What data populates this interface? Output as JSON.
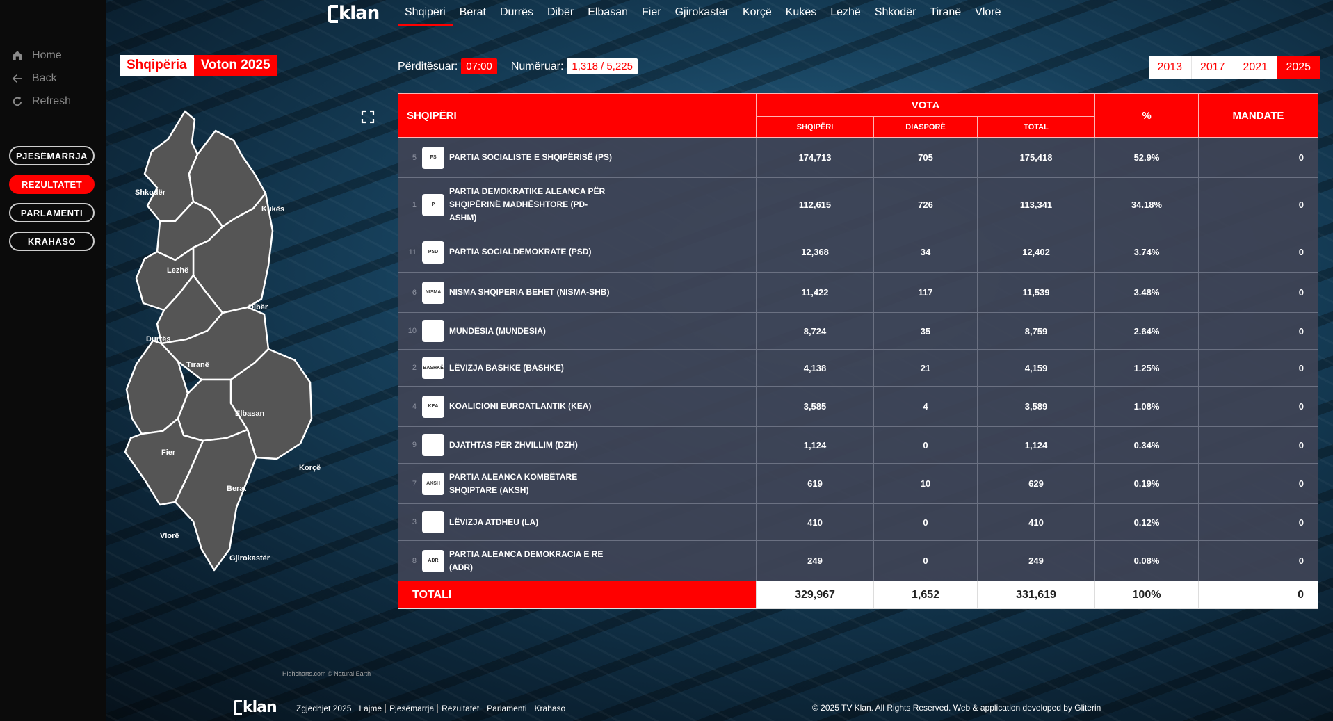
{
  "brand": {
    "logo_text": "klan",
    "footer_logo_text": "klan"
  },
  "sidebar": {
    "home": "Home",
    "back": "Back",
    "refresh": "Refresh",
    "buttons": [
      "PJESËMARRJA",
      "REZULTATET",
      "PARLAMENTI",
      "KRAHASO"
    ],
    "active_button": "REZULTATET"
  },
  "nav": {
    "items": [
      "Shqipëri",
      "Berat",
      "Durrës",
      "Dibër",
      "Elbasan",
      "Fier",
      "Gjirokastër",
      "Korçë",
      "Kukës",
      "Lezhë",
      "Shkodër",
      "Tiranë",
      "Vlorë"
    ],
    "active": "Shqipëri"
  },
  "badge": {
    "left": "Shqipëria",
    "right": "Voton 2025"
  },
  "status": {
    "updated_label": "Përditësuar:",
    "updated_value": "07:00",
    "counted_label": "Numëruar:",
    "counted_value": "1,318 / 5,225"
  },
  "years": {
    "items": [
      "2013",
      "2017",
      "2021",
      "2025"
    ],
    "active": "2025"
  },
  "map": {
    "labels": [
      "Shkodër",
      "Kukës",
      "Lezhë",
      "Dibër",
      "Durrës",
      "Tiranë",
      "Elbasan",
      "Fier",
      "Korçë",
      "Berat",
      "Vlorë",
      "Gjirokastër"
    ],
    "credits": "Highcharts.com © Natural Earth"
  },
  "table": {
    "headers": {
      "region": "SHQIPËRI",
      "votes": "VOTA",
      "percent": "%",
      "seats": "MANDATE",
      "sub_domestic": "SHQIPËRI",
      "sub_diaspora": "DIASPORË",
      "sub_total": "TOTAL"
    },
    "rows": [
      {
        "index": "5",
        "logo": "PS",
        "name": "PARTIA SOCIALISTE E SHQIPËRISË (PS)",
        "domestic": "174,713",
        "diaspora": "705",
        "total": "175,418",
        "percent": "52.9%",
        "seats": "0"
      },
      {
        "index": "1",
        "logo": "P",
        "name": "PARTIA DEMOKRATIKE ALEANCA PËR SHQIPËRINË MADHËSHTORE (PD-ASHM)",
        "domestic": "112,615",
        "diaspora": "726",
        "total": "113,341",
        "percent": "34.18%",
        "seats": "0"
      },
      {
        "index": "11",
        "logo": "PSD",
        "name": "PARTIA SOCIALDEMOKRATE (PSD)",
        "domestic": "12,368",
        "diaspora": "34",
        "total": "12,402",
        "percent": "3.74%",
        "seats": "0"
      },
      {
        "index": "6",
        "logo": "NISMA",
        "name": "NISMA SHQIPERIA BEHET (NISMA-SHB)",
        "domestic": "11,422",
        "diaspora": "117",
        "total": "11,539",
        "percent": "3.48%",
        "seats": "0"
      },
      {
        "index": "10",
        "logo": "",
        "name": "MUNDËSIA (MUNDESIA)",
        "domestic": "8,724",
        "diaspora": "35",
        "total": "8,759",
        "percent": "2.64%",
        "seats": "0"
      },
      {
        "index": "2",
        "logo": "BASHKË",
        "name": "LËVIZJA BASHKË (BASHKE)",
        "domestic": "4,138",
        "diaspora": "21",
        "total": "4,159",
        "percent": "1.25%",
        "seats": "0"
      },
      {
        "index": "4",
        "logo": "KEA",
        "name": "KOALICIONI EUROATLANTIK (KEA)",
        "domestic": "3,585",
        "diaspora": "4",
        "total": "3,589",
        "percent": "1.08%",
        "seats": "0"
      },
      {
        "index": "9",
        "logo": "",
        "name": "DJATHTAS PËR ZHVILLIM (DZH)",
        "domestic": "1,124",
        "diaspora": "0",
        "total": "1,124",
        "percent": "0.34%",
        "seats": "0"
      },
      {
        "index": "7",
        "logo": "AKSH",
        "name": "PARTIA ALEANCA KOMBËTARE SHQIPTARE (AKSH)",
        "domestic": "619",
        "diaspora": "10",
        "total": "629",
        "percent": "0.19%",
        "seats": "0"
      },
      {
        "index": "3",
        "logo": "",
        "name": "LËVIZJA ATDHEU (LA)",
        "domestic": "410",
        "diaspora": "0",
        "total": "410",
        "percent": "0.12%",
        "seats": "0"
      },
      {
        "index": "8",
        "logo": "ADR",
        "name": "PARTIA ALEANCA DEMOKRACIA E RE (ADR)",
        "domestic": "249",
        "diaspora": "0",
        "total": "249",
        "percent": "0.08%",
        "seats": "0"
      }
    ],
    "totals": {
      "label": "TOTALI",
      "domestic": "329,967",
      "diaspora": "1,652",
      "total": "331,619",
      "percent": "100%",
      "seats": "0"
    }
  },
  "footer": {
    "links": [
      "Zgjedhjet 2025",
      "Lajme",
      "Pjesëmarrja",
      "Rezultatet",
      "Parlamenti",
      "Krahaso"
    ],
    "copyright": "© 2025 TV Klan. All Rights Reserved. Web & application developed by Gliterin"
  },
  "colors": {
    "accent": "#ff0000",
    "row_bg": "#3e4355",
    "sidebar_bg": "#0b0b0b"
  },
  "icons": {
    "home": "home-icon",
    "back": "arrow-left-icon",
    "refresh": "refresh-icon",
    "fullscreen": "fullscreen-icon"
  }
}
